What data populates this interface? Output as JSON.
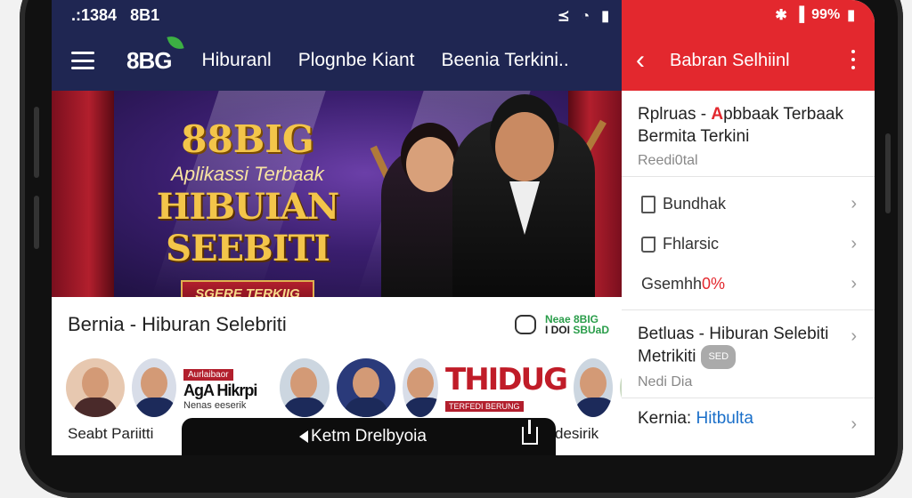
{
  "left": {
    "status_time": ".:1384",
    "status_extra": "8B1",
    "status_icons": [
      "wifi-icon",
      "signal-icon",
      "battery-icon"
    ],
    "logo": "8BG",
    "nav": [
      "Hiburanl",
      "Plognbe Kiant",
      "Beenia Terkini.."
    ],
    "banner": {
      "brand": "88BIG",
      "tagline": "Aplikassi Terbaak",
      "title": "HIBUIAN SEEBITI",
      "badge": "SGERE TERKIIG"
    },
    "section_title": "Bernia - Hiburan Selebriti",
    "mini_brand": [
      "Neae",
      "8BIG",
      "I DOI",
      "SBUaD"
    ],
    "promo": {
      "tag": "Aurlaibaor",
      "name": "AgA Hikrpi",
      "sub": "Nenas eeserik"
    },
    "thidu": {
      "title": "THIDUG",
      "sub": "TERFEDI BERUNG"
    },
    "caption_left": "Seabt Pariitti",
    "caption_right": "desirik",
    "toast": "Ketm Drelbyoia"
  },
  "right": {
    "status": "99%",
    "title": "Babran Selhiinl",
    "card1": {
      "prefix": "Rplruas -",
      "accent": "A",
      "rest": "pbbaak Terbaak Bermita Terkini",
      "meta": "Reedi0tal"
    },
    "menu": [
      {
        "icon": "phone-icon",
        "label": "Bundhak"
      },
      {
        "icon": "refresh-icon",
        "label": "Fhlarsic"
      },
      {
        "icon": "",
        "label": "Gsemhh",
        "pct": "0%"
      }
    ],
    "card2": {
      "title": "Betluas - Hiburan Selebiti Metrikiti",
      "pill": "SED",
      "meta": "Nedi Dia"
    },
    "card3": {
      "label": "Kernia:",
      "highlight": "Hitbulta"
    }
  },
  "colors": {
    "left_nav": "#1f2652",
    "right_accent": "#e3282e"
  }
}
